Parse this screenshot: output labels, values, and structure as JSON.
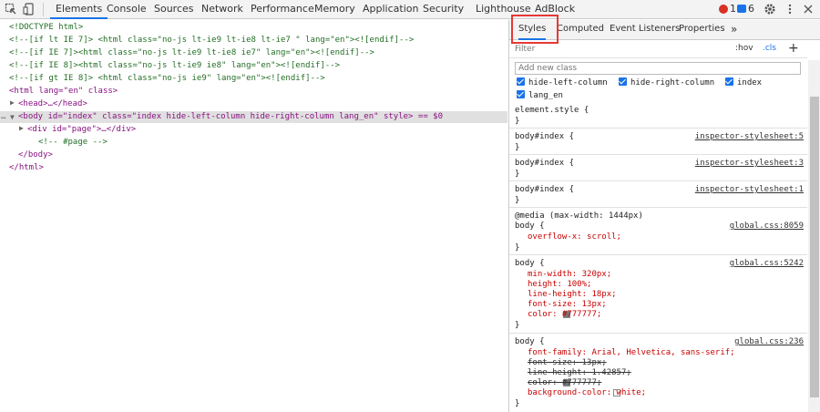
{
  "toolbar": {
    "tabs": [
      "Elements",
      "Console",
      "Sources",
      "Network",
      "Performance",
      "Memory",
      "Application",
      "Security",
      "Lighthouse",
      "AdBlock"
    ],
    "error_count": "1",
    "message_count": "6"
  },
  "elements": {
    "lines": [
      "<!DOCTYPE html>",
      "<!--[if lt IE 7]> <html class=\"no-js lt-ie9 lt-ie8 lt-ie7 \" lang=\"en\"><![endif]-->",
      "<!--[if IE 7]><html class=\"no-js lt-ie9 lt-ie8 ie7\" lang=\"en\"><![endif]-->",
      "<!--[if IE 8]><html class=\"no-js lt-ie9 ie8\" lang=\"en\"><![endif]-->",
      "<!--[if gt IE 8]> <html class=\"no-js ie9\" lang=\"en\"><![endif]-->",
      "<html lang=\"en\" class>",
      "<head>…</head>",
      "<body id=\"index\" class=\"index hide-left-column hide-right-column lang_en\" style> == $0",
      "<div id=\"page\">…</div>",
      "<!-- #page -->",
      "</body>",
      "</html>"
    ]
  },
  "styles": {
    "tabs": [
      "Styles",
      "Computed",
      "Event Listeners",
      "Properties"
    ],
    "more": "»",
    "filter_placeholder": "Filter",
    "hov": ":hov",
    "cls": ".cls",
    "plus": "+",
    "class_placeholder": "Add new class",
    "class_checkboxes": [
      "hide-left-column",
      "hide-right-column",
      "index",
      "lang_en"
    ],
    "rules": [
      {
        "selector": "element.style {",
        "source": "",
        "props": [],
        "close": "}"
      },
      {
        "selector": "body#index {",
        "source": "inspector-stylesheet:5",
        "props": [],
        "close": "}"
      },
      {
        "selector": "body#index {",
        "source": "inspector-stylesheet:3",
        "props": [],
        "close": "}"
      },
      {
        "selector": "body#index {",
        "source": "inspector-stylesheet:1",
        "props": [],
        "close": "}"
      },
      {
        "media": "@media (max-width: 1444px)",
        "selector": "body {",
        "source": "global.css:8059",
        "props": [
          "overflow-x: scroll;"
        ],
        "close": "}"
      },
      {
        "selector": "body {",
        "source": "global.css:5242",
        "props": [
          "min-width: 320px;",
          "height: 100%;",
          "line-height: 18px;",
          "font-size: 13px;",
          "color: #777777;"
        ],
        "close": "}"
      },
      {
        "selector": "body {",
        "source": "global.css:236",
        "props": [
          "font-family: Arial, Helvetica, sans-serif;",
          "font-size: 13px;",
          "line-height: 1.42857;",
          "color: #777777;",
          "background-color: white;"
        ],
        "close": "}"
      }
    ]
  },
  "colors": {
    "accent": "#1a73e8",
    "highlight_box": "#e53935",
    "error": "#d93025"
  }
}
